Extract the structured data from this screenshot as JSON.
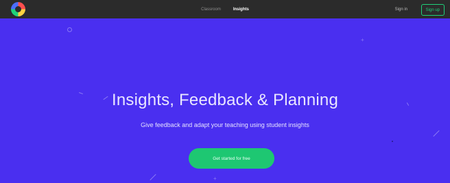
{
  "nav": {
    "brand_icon": "logo-icon",
    "links": [
      {
        "label": "Classroom",
        "active": false
      },
      {
        "label": "Insights",
        "active": true
      }
    ],
    "sign_in": "Sign in",
    "sign_up": "Sign up"
  },
  "hero": {
    "title": "Insights, Feedback & Planning",
    "subtitle": "Give feedback and adapt your teaching using student insights",
    "cta_label": "Get started for free"
  },
  "colors": {
    "hero_background": "#4a2ff0",
    "topbar_background": "#2b2b2b",
    "accent_green": "#1ec772"
  }
}
